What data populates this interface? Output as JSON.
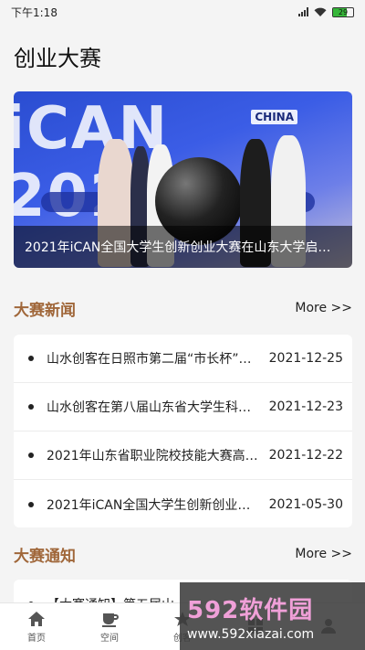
{
  "status_bar": {
    "time": "下午1:18",
    "battery": "29"
  },
  "page_title": "创业大赛",
  "banner": {
    "bg_text": "iCAN 2021",
    "china_tag": "CHINA",
    "caption": "2021年iCAN全国大学生创新创业大赛在山东大学启动…"
  },
  "news_section": {
    "title": "大赛新闻",
    "more": "More >>",
    "items": [
      {
        "title": "山水创客在日照市第二届“市长杯”…",
        "date": "2021-12-25"
      },
      {
        "title": "山水创客在第八届山东省大学生科…",
        "date": "2021-12-23"
      },
      {
        "title": "2021年山东省职业院校技能大赛高…",
        "date": "2021-12-22"
      },
      {
        "title": "2021年iCAN全国大学生创新创业大…",
        "date": "2021-05-30"
      }
    ]
  },
  "notice_section": {
    "title": "大赛通知",
    "more": "More >>",
    "first_item": "【大赛通知】第五届山"
  },
  "tab_bar": {
    "tabs": [
      {
        "label": "首页",
        "icon": "home-icon"
      },
      {
        "label": "空间",
        "icon": "coffee-cup-icon"
      },
      {
        "label": "创客",
        "icon": "star-icon"
      },
      {
        "label": "",
        "icon": "grid-icon"
      },
      {
        "label": "",
        "icon": "user-icon"
      }
    ]
  },
  "watermark": {
    "brand": "592软件园",
    "url": "www.592xiazai.com"
  },
  "colors": {
    "section_title": "#a0673a",
    "background": "#f4f4f4"
  }
}
